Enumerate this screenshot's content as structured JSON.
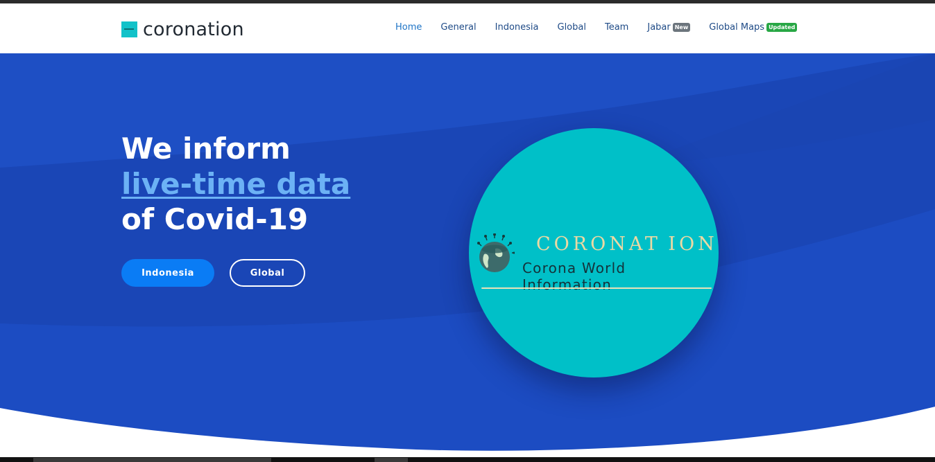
{
  "brand": {
    "name": "coronation",
    "logo_icon": "coronation-logo-icon"
  },
  "nav": {
    "items": [
      {
        "label": "Home",
        "active": true
      },
      {
        "label": "General"
      },
      {
        "label": "Indonesia"
      },
      {
        "label": "Global"
      },
      {
        "label": "Team"
      },
      {
        "label": "Jabar",
        "badge": "New",
        "badge_color": "#6c757d"
      },
      {
        "label": "Global Maps",
        "badge": "Updated",
        "badge_color": "#28a745"
      }
    ]
  },
  "hero": {
    "line1": "We inform",
    "line2": "live-time data",
    "line3": "of Covid-19",
    "buttons": {
      "primary": "Indonesia",
      "secondary": "Global"
    },
    "colors": {
      "bg": "#1b47b8",
      "accent_link": "#6cb2f5",
      "primary_button": "#0a7cf5"
    }
  },
  "logo_card": {
    "title": "CORONAT ION",
    "subtitle": "Corona World Information",
    "bg_color": "#00c0c8",
    "icon": "virus-globe-icon"
  }
}
